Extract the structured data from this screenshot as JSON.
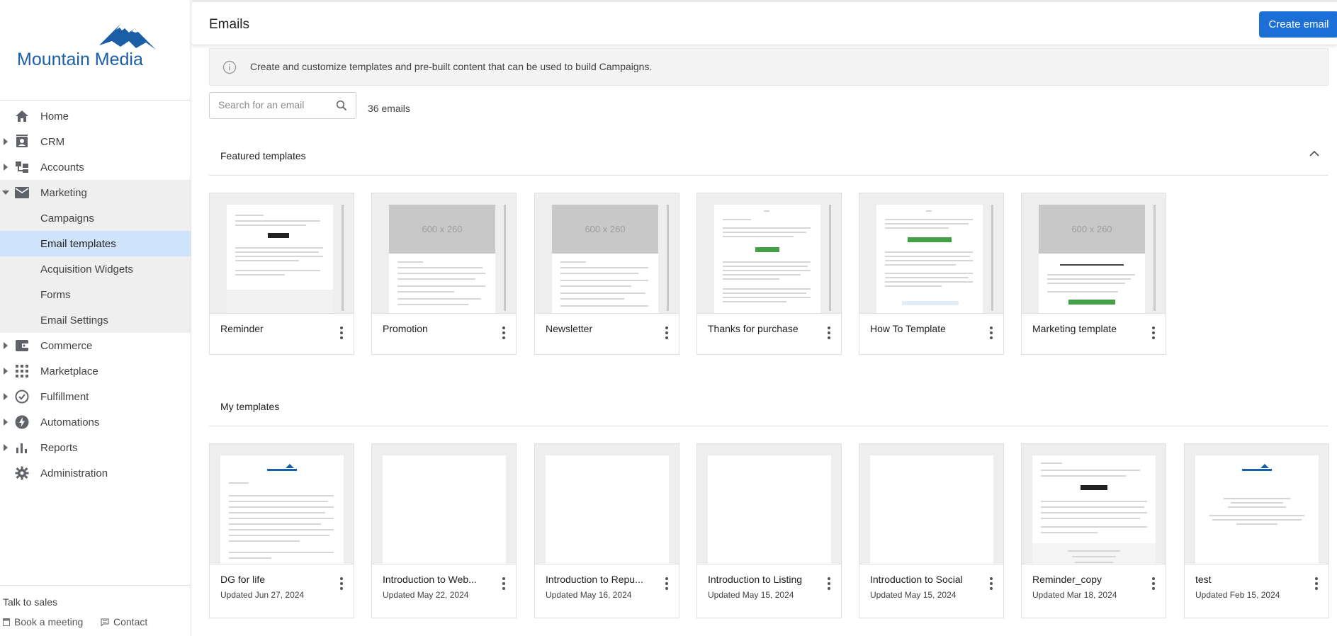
{
  "brand": {
    "name": "Mountain Media",
    "color": "#1b5ea8"
  },
  "sidebar": {
    "items": [
      {
        "label": "Home",
        "icon": "home-icon"
      },
      {
        "label": "CRM",
        "icon": "contacts-icon"
      },
      {
        "label": "Accounts",
        "icon": "accounts-icon"
      },
      {
        "label": "Marketing",
        "icon": "mail-icon"
      },
      {
        "label": "Commerce",
        "icon": "wallet-icon"
      },
      {
        "label": "Marketplace",
        "icon": "grid-icon"
      },
      {
        "label": "Fulfillment",
        "icon": "check-circle-icon"
      },
      {
        "label": "Automations",
        "icon": "bolt-icon"
      },
      {
        "label": "Reports",
        "icon": "bar-chart-icon"
      },
      {
        "label": "Administration",
        "icon": "gear-icon"
      }
    ],
    "marketing_children": [
      {
        "label": "Campaigns"
      },
      {
        "label": "Email templates",
        "active": true
      },
      {
        "label": "Acquisition Widgets"
      },
      {
        "label": "Forms"
      },
      {
        "label": "Email Settings"
      }
    ],
    "footer": {
      "talk_label": "Talk to sales",
      "book_label": "Book a meeting",
      "contact_label": "Contact"
    }
  },
  "header": {
    "title": "Emails",
    "create_label": "Create email"
  },
  "info": {
    "text": "Create and customize templates and pre-built content that can be used to build Campaigns."
  },
  "search": {
    "placeholder": "Search for an email",
    "count_text": "36 emails"
  },
  "featured": {
    "title": "Featured templates",
    "cards": [
      {
        "title": "Reminder"
      },
      {
        "title": "Promotion",
        "placeholder": "600 x 260"
      },
      {
        "title": "Newsletter",
        "placeholder": "600 x 260"
      },
      {
        "title": "Thanks for purchase"
      },
      {
        "title": "How To Template"
      },
      {
        "title": "Marketing template",
        "placeholder": "600 x 260"
      }
    ]
  },
  "mine": {
    "title": "My templates",
    "cards": [
      {
        "title": "DG for life",
        "updated": "Updated Jun 27, 2024"
      },
      {
        "title": "Introduction to Web...",
        "updated": "Updated May 22, 2024"
      },
      {
        "title": "Introduction to Repu...",
        "updated": "Updated May 16, 2024"
      },
      {
        "title": "Introduction to Listing",
        "updated": "Updated May 15, 2024"
      },
      {
        "title": "Introduction to Social",
        "updated": "Updated May 15, 2024"
      },
      {
        "title": "Reminder_copy",
        "updated": "Updated Mar 18, 2024"
      },
      {
        "title": "test",
        "updated": "Updated Feb 15, 2024"
      }
    ]
  },
  "colors": {
    "accent": "#1b6fd6",
    "active_nav": "#cfe4fb",
    "success": "#43a047"
  }
}
